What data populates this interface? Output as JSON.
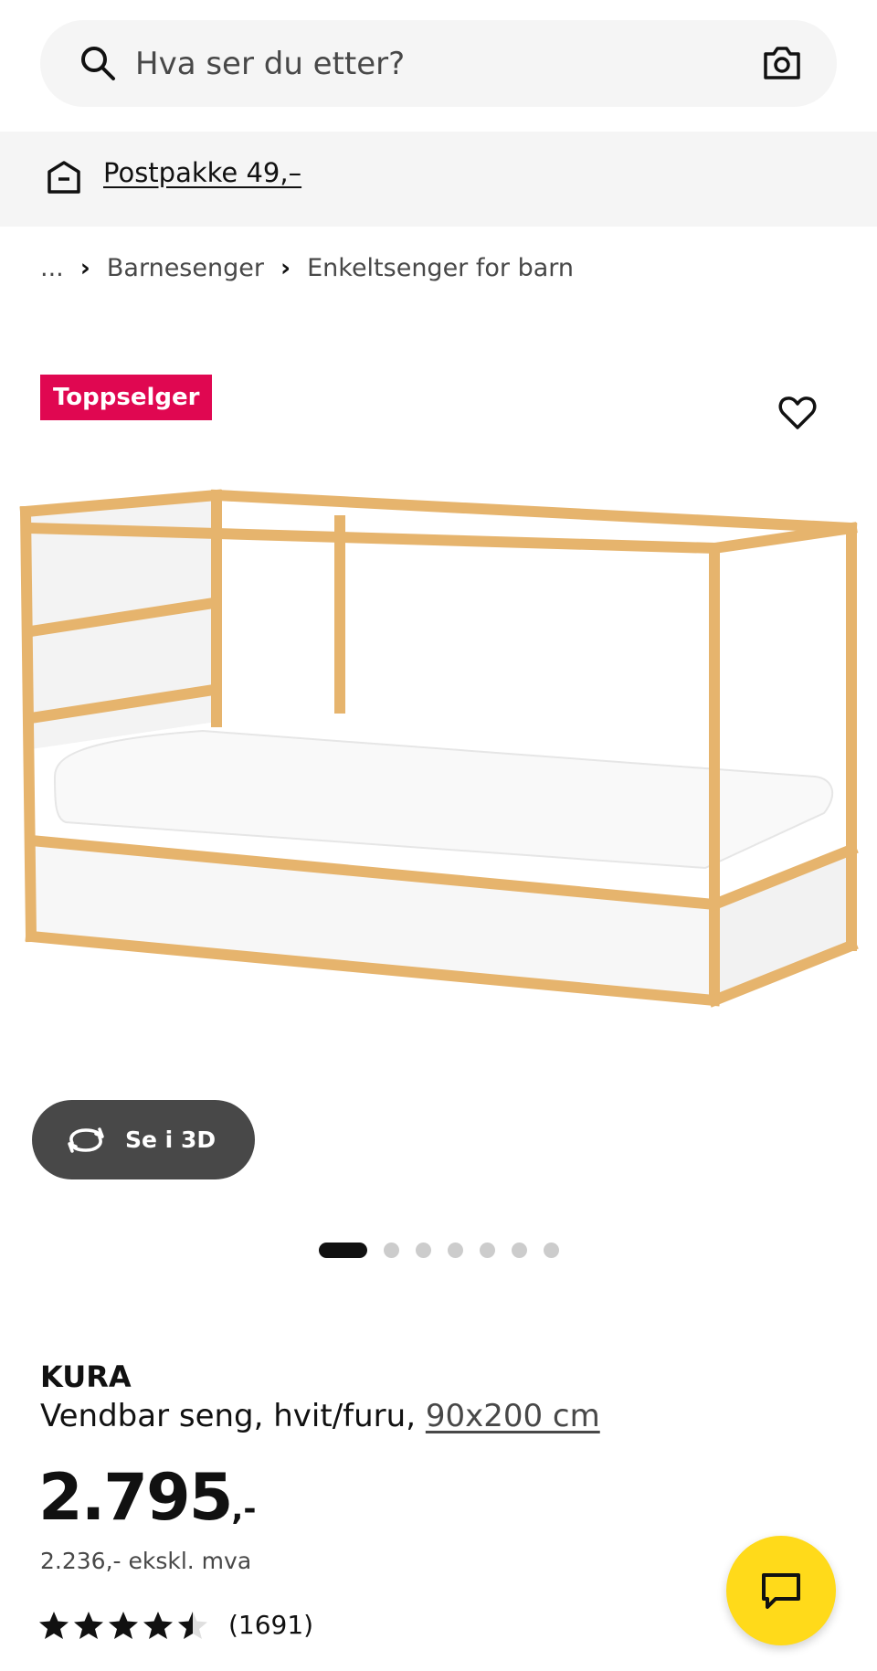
{
  "search": {
    "placeholder": "Hva ser du etter?"
  },
  "promo": {
    "label": "Postpakke 49,–"
  },
  "breadcrumb": {
    "ellipsis": "...",
    "items": [
      "Barnesenger",
      "Enkeltsenger for barn"
    ]
  },
  "badge": {
    "label": "Toppselger"
  },
  "view3d": {
    "label": "Se i 3D"
  },
  "gallery": {
    "total": 7,
    "active_index": 0
  },
  "product": {
    "name": "KURA",
    "description": "Vendbar seng, hvit/furu,",
    "size": "90x200 cm",
    "price_int": "2.795",
    "price_suffix": ",-",
    "vat_note": "2.236,- ekskl. mva",
    "rating": 4.5,
    "rating_count": "(1691)"
  },
  "colors": {
    "badge": "#e00751",
    "chat": "#ffda1a",
    "view3d_bg": "#484848",
    "wood": "#e8b56f"
  },
  "icons": [
    "search-icon",
    "camera-icon",
    "box-icon",
    "heart-icon",
    "rotate-3d-icon",
    "star-icon",
    "chat-icon"
  ]
}
